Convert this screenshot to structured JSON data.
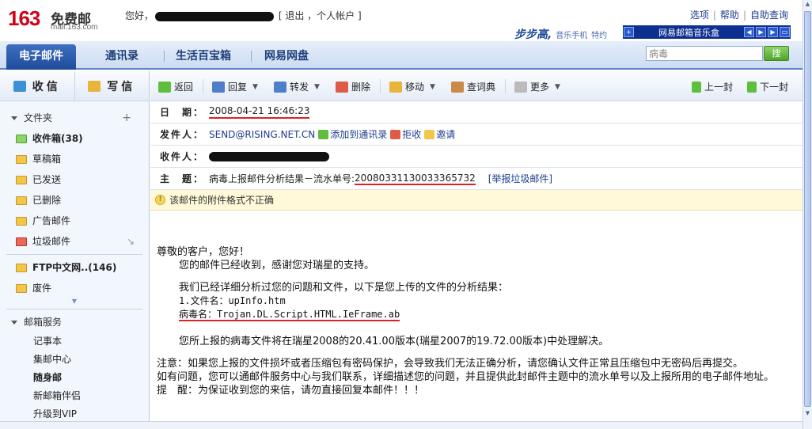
{
  "header": {
    "logo_number": "163",
    "logo_text": "免费邮",
    "logo_domain": "mail.163.com",
    "greeting": "您好，",
    "logout": "[ 退出",
    "account": "，个人帐户 ]",
    "top_links": [
      "选项",
      "帮助",
      "自助查询"
    ],
    "ad_brand": "步步高",
    "ad_text": "音乐手机",
    "ad_sub": "特约",
    "music_box": "网易邮箱音乐盒"
  },
  "nav": {
    "tabs": [
      "电子邮件",
      "通讯录",
      "生活百宝箱",
      "网易网盘"
    ],
    "search_value": "病毒",
    "search_button": "搜"
  },
  "sidebar": {
    "receive": "收信",
    "compose": "写信",
    "folders_title": "文件夹",
    "folders": [
      {
        "label": "收件箱(38)",
        "bold": true
      },
      {
        "label": "草稿箱",
        "bold": false
      },
      {
        "label": "已发送",
        "bold": false
      },
      {
        "label": "已删除",
        "bold": false
      },
      {
        "label": "广告邮件",
        "bold": false
      },
      {
        "label": "垃圾邮件",
        "bold": false
      },
      {
        "label": "FTP中文网..(146)",
        "bold": true
      },
      {
        "label": "废件",
        "bold": false
      }
    ],
    "services_title": "邮箱服务",
    "services": [
      "记事本",
      "集邮中心",
      "随身邮",
      "新邮箱伴侣",
      "升级到VIP"
    ]
  },
  "toolbar": {
    "back": "返回",
    "reply": "回复",
    "forward": "转发",
    "delete": "删除",
    "move": "移动",
    "dictionary": "查词典",
    "more": "更多",
    "prev": "上一封",
    "next": "下一封"
  },
  "meta": {
    "date_label": "日　期：",
    "date_value": "2008-04-21 16:46:23",
    "from_label": "发件人：",
    "from_value": "SEND@RISING.NET.CN",
    "add_contact": "添加到通讯录",
    "reject": "拒收",
    "invite": "邀请",
    "to_label": "收件人：",
    "subject_label": "主　题：",
    "subject_prefix": "病毒上报邮件分析结果－流水单号:",
    "subject_id": "20080331130033365732",
    "report_spam": "[举报垃圾邮件]",
    "warning": "该邮件的附件格式不正确"
  },
  "body": {
    "greeting": "尊敬的客户，您好！",
    "line1": "您的邮件已经收到，感谢您对瑞星的支持。",
    "line2": "我们已经详细分析过您的问题和文件，以下是您上传的文件的分析结果：",
    "file_line": "1.文件名：upInfo.htm",
    "virus_label": "病毒名：",
    "virus_name": "Trojan.DL.Script.HTML.IeFrame.ab",
    "line3": "您所上报的病毒文件将在瑞星2008的20.41.00版本(瑞星2007的19.72.00版本)中处理解决。",
    "note": "注意：如果您上报的文件损坏或者压缩包有密码保护，会导致我们无法正确分析，请您确认文件正常且压缩包中无密码后再提交。",
    "contact": "如有问题，您可以通邮件服务中心与我们联系，详细描述您的问题，并且提供此封邮件主题中的流水单号以及上报所用的电子邮件地址。",
    "reminder": "提　醒：为保证收到您的来信，请勿直接回复本邮件！！！"
  },
  "colors": {
    "nav_active": "#2a5aa8",
    "link": "#1c3c8c",
    "brand_red": "#d0021b",
    "warning_bg": "#fff9d9"
  }
}
